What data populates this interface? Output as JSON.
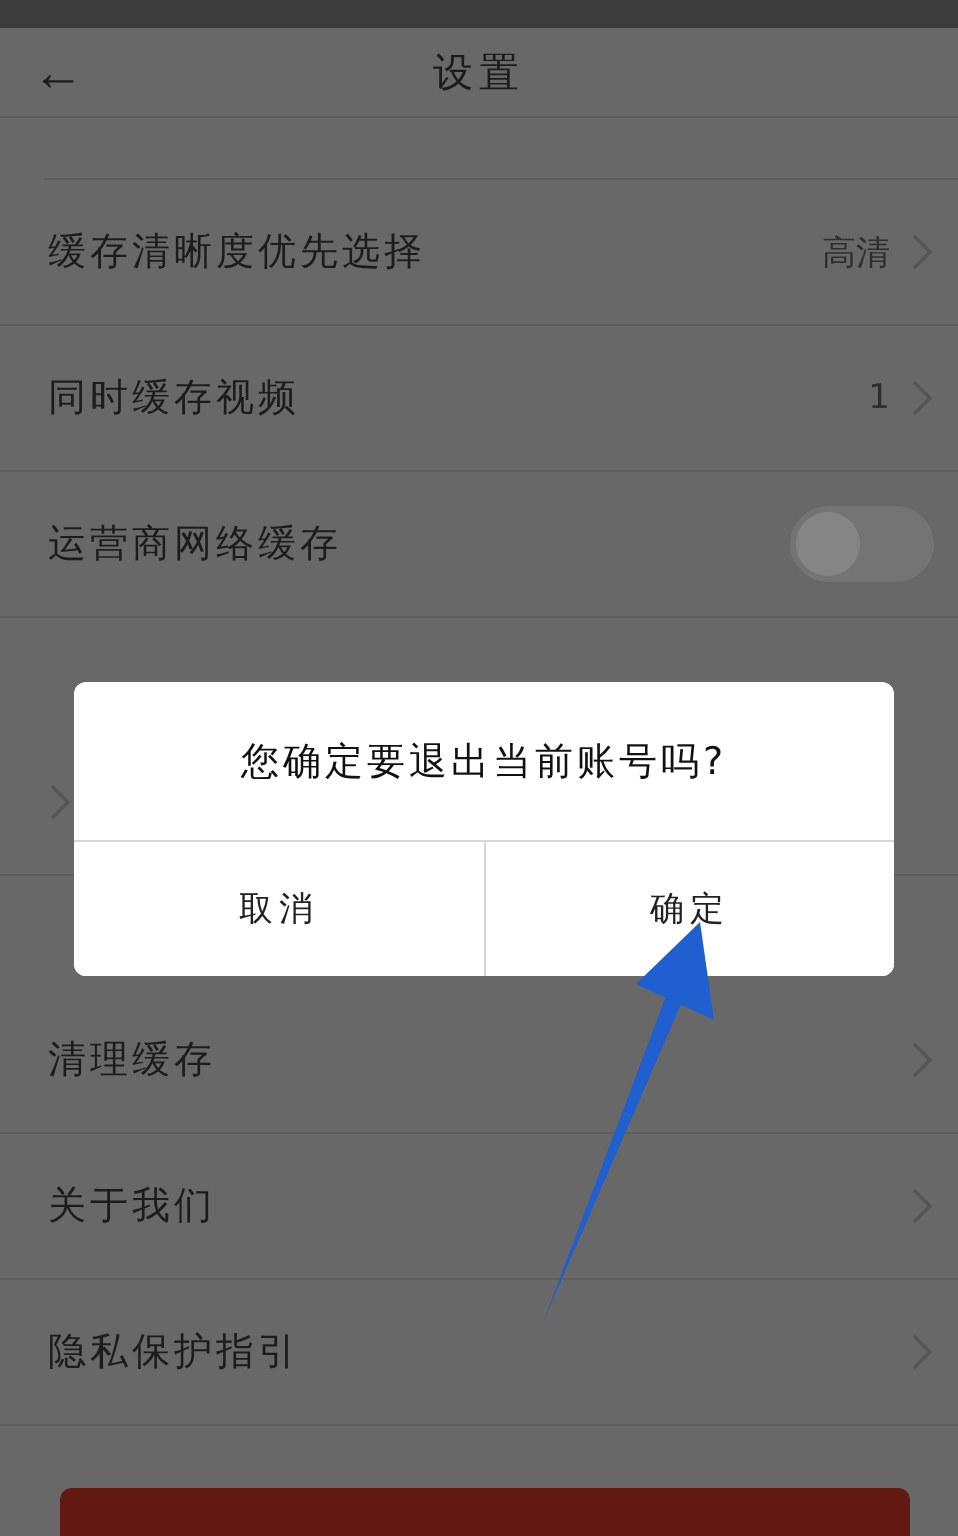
{
  "header": {
    "back_icon": "←",
    "title": "设置"
  },
  "items": [
    {
      "kind": "row",
      "label": "缓存清晰度优先选择",
      "value": "高清"
    },
    {
      "kind": "row",
      "label": "同时缓存视频",
      "value": "1"
    },
    {
      "kind": "toggle",
      "label": "运营商网络缓存",
      "on": false
    },
    {
      "kind": "section"
    },
    {
      "kind": "row"
    },
    {
      "kind": "section"
    },
    {
      "kind": "row",
      "label": "清理缓存"
    },
    {
      "kind": "row",
      "label": "关于我们"
    },
    {
      "kind": "row",
      "label": "隐私保护指引"
    }
  ],
  "dialog": {
    "message": "您确定要退出当前账号吗?",
    "buttons": [
      "取消",
      "确定"
    ]
  }
}
